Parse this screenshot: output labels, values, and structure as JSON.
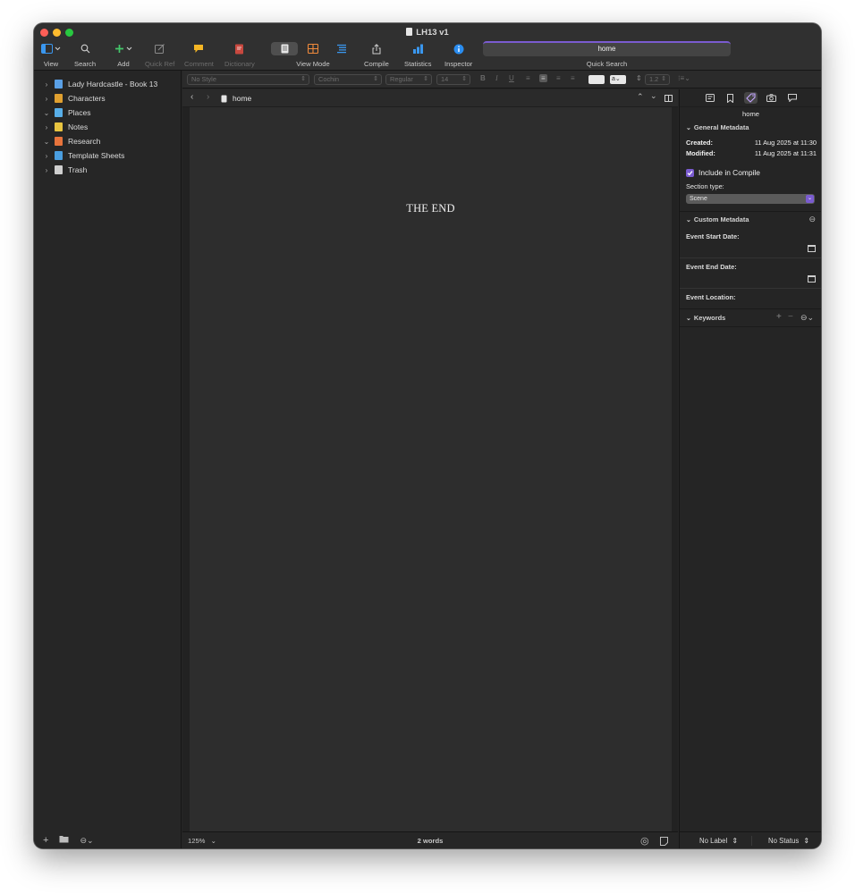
{
  "window": {
    "title": "LH13 v1"
  },
  "toolbar": {
    "view": "View",
    "search": "Search",
    "add": "Add",
    "quick_ref": "Quick Ref",
    "comment": "Comment",
    "dictionary": "Dictionary",
    "view_mode": "View Mode",
    "compile": "Compile",
    "statistics": "Statistics",
    "inspector": "Inspector",
    "quick_search_value": "home",
    "quick_search": "Quick Search"
  },
  "binder": {
    "items": [
      {
        "label": "Lady Hardcastle - Book 13",
        "chevron": "›",
        "icon": "book-icon",
        "color": "#5aa0e6"
      },
      {
        "label": "Characters",
        "chevron": "›",
        "icon": "people-icon",
        "color": "#e0a030"
      },
      {
        "label": "Places",
        "chevron": "⌄",
        "icon": "map-icon",
        "color": "#58aee8"
      },
      {
        "label": "Notes",
        "chevron": "›",
        "icon": "notepad-icon",
        "color": "#e8c440"
      },
      {
        "label": "Research",
        "chevron": "⌄",
        "icon": "research-folder-icon",
        "color": "#e8743c"
      },
      {
        "label": "Template Sheets",
        "chevron": "›",
        "icon": "template-icon",
        "color": "#4a9ee0"
      },
      {
        "label": "Trash",
        "chevron": "›",
        "icon": "trash-icon",
        "color": "#cfcfcf"
      }
    ]
  },
  "format_bar": {
    "style": "No Style",
    "font": "Cochin",
    "weight": "Regular",
    "size": "14",
    "line_spacing": "1.2"
  },
  "editor": {
    "document_title": "home",
    "text": "THE END",
    "zoom": "125%",
    "word_count": "2 words"
  },
  "inspector": {
    "document_title": "home",
    "general_metadata": "General Metadata",
    "created_label": "Created:",
    "created_value": "11 Aug 2025 at 11:30",
    "modified_label": "Modified:",
    "modified_value": "11 Aug 2025 at 11:31",
    "include_in_compile": "Include in Compile",
    "section_type_label": "Section type:",
    "section_type_value": "Scene",
    "custom_metadata": "Custom Metadata",
    "event_start_date": "Event Start Date:",
    "event_end_date": "Event End Date:",
    "event_location": "Event Location:",
    "keywords": "Keywords",
    "label": "No Label",
    "status": "No Status"
  },
  "colors": {
    "accent": "#7a5bd0",
    "traffic_close": "#fe5f57",
    "traffic_minimize": "#febc2e",
    "traffic_maximize": "#28c840",
    "comment_icon": "#f5b625",
    "dictionary_icon": "#c8483f",
    "statistics_icon": "#3a97ef",
    "inspector_icon": "#2a8df0"
  }
}
